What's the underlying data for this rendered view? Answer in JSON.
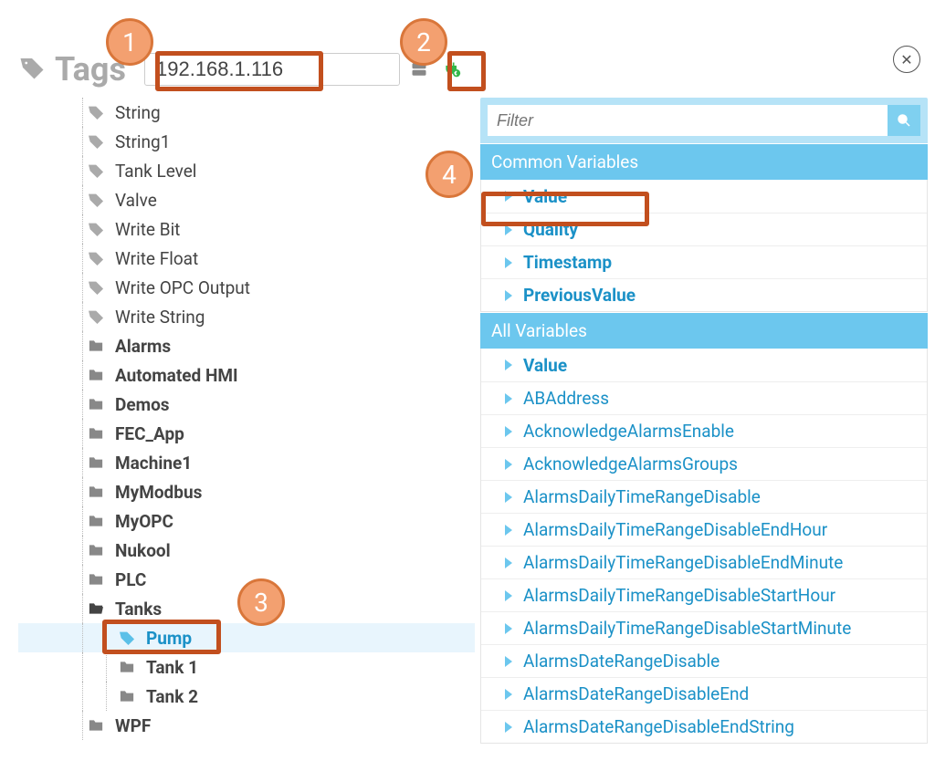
{
  "header": {
    "title": "Tags",
    "ip_value": "192.168.1.116"
  },
  "tree": {
    "tags": [
      "String",
      "String1",
      "Tank Level",
      "Valve",
      "Write Bit",
      "Write Float",
      "Write OPC Output",
      "Write String"
    ],
    "folders": [
      "Alarms",
      "Automated HMI",
      "Demos",
      "FEC_App",
      "Machine1",
      "MyModbus",
      "MyOPC",
      "Nukool",
      "PLC"
    ],
    "open_folder": "Tanks",
    "open_children": {
      "pump": "Pump",
      "tank1": "Tank 1",
      "tank2": "Tank 2"
    },
    "last_folder": "WPF"
  },
  "right_panel": {
    "filter_placeholder": "Filter",
    "section_common": "Common Variables",
    "common_vars": [
      "Value",
      "Quality",
      "Timestamp",
      "PreviousValue"
    ],
    "section_all": "All Variables",
    "all_vars": [
      "Value",
      "ABAddress",
      "AcknowledgeAlarmsEnable",
      "AcknowledgeAlarmsGroups",
      "AlarmsDailyTimeRangeDisable",
      "AlarmsDailyTimeRangeDisableEndHour",
      "AlarmsDailyTimeRangeDisableEndMinute",
      "AlarmsDailyTimeRangeDisableStartHour",
      "AlarmsDailyTimeRangeDisableStartMinute",
      "AlarmsDateRangeDisable",
      "AlarmsDateRangeDisableEnd",
      "AlarmsDateRangeDisableEndString"
    ]
  },
  "badges": {
    "b1": "1",
    "b2": "2",
    "b3": "3",
    "b4": "4"
  }
}
